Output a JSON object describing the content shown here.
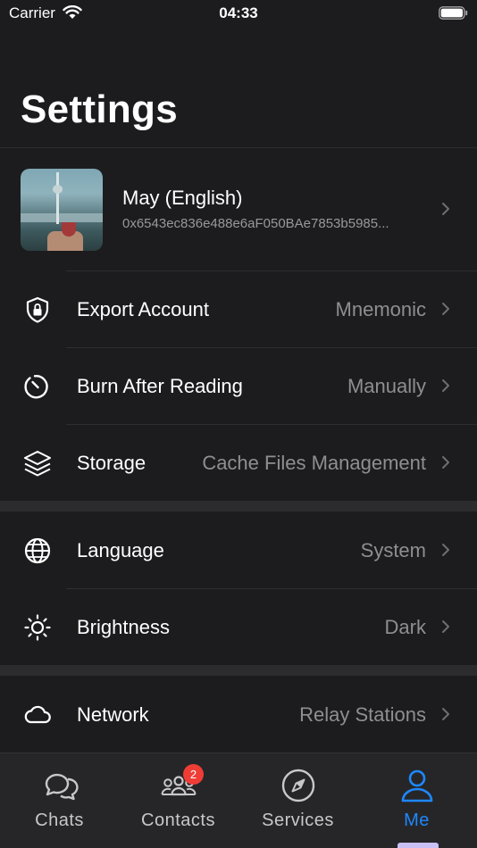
{
  "status_bar": {
    "carrier": "Carrier",
    "time": "04:33"
  },
  "page": {
    "title": "Settings"
  },
  "profile": {
    "name": "May (English)",
    "address": "0x6543ec836e488e6aF050BAe7853b5985..."
  },
  "sections": [
    {
      "rows": [
        {
          "icon": "shield-lock-icon",
          "label": "Export Account",
          "value": "Mnemonic"
        },
        {
          "icon": "timer-icon",
          "label": "Burn After Reading",
          "value": "Manually"
        },
        {
          "icon": "layers-icon",
          "label": "Storage",
          "value": "Cache Files Management"
        }
      ]
    },
    {
      "rows": [
        {
          "icon": "globe-icon",
          "label": "Language",
          "value": "System"
        },
        {
          "icon": "sun-icon",
          "label": "Brightness",
          "value": "Dark"
        }
      ]
    },
    {
      "rows": [
        {
          "icon": "cloud-icon",
          "label": "Network",
          "value": "Relay Stations"
        }
      ]
    }
  ],
  "tab_bar": {
    "tabs": [
      {
        "icon": "chat-bubbles-icon",
        "label": "Chats"
      },
      {
        "icon": "contacts-icon",
        "label": "Contacts",
        "badge": "2"
      },
      {
        "icon": "compass-icon",
        "label": "Services"
      },
      {
        "icon": "person-icon",
        "label": "Me",
        "active": true
      }
    ]
  },
  "colors": {
    "background": "#1c1c1e",
    "secondary_text": "#8e8e93",
    "accent": "#1e88ff",
    "badge": "#ef3d36"
  }
}
